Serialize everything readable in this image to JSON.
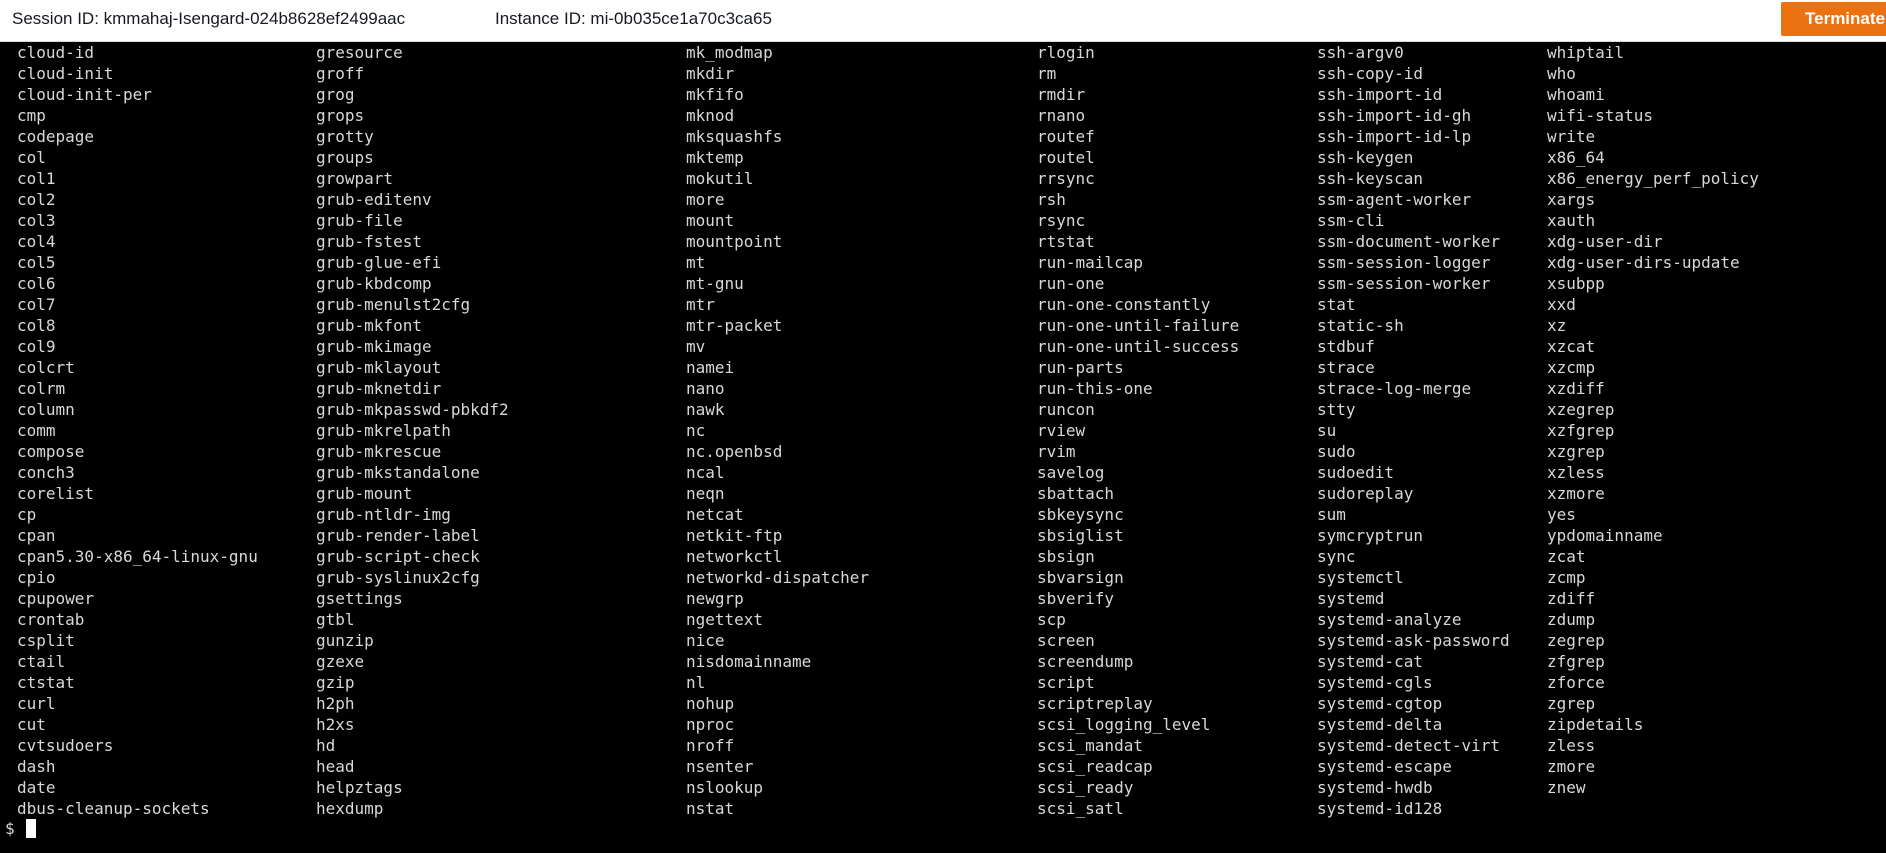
{
  "header": {
    "session_label": "Session ID: kmmahaj-Isengard-024b8628ef2499aac",
    "instance_label": "Instance ID: mi-0b035ce1a70c3ca65",
    "terminate_label": "Terminate"
  },
  "terminal": {
    "prompt": "$",
    "columns": [
      [
        "cloud-id",
        "cloud-init",
        "cloud-init-per",
        "cmp",
        "codepage",
        "col",
        "col1",
        "col2",
        "col3",
        "col4",
        "col5",
        "col6",
        "col7",
        "col8",
        "col9",
        "colcrt",
        "colrm",
        "column",
        "comm",
        "compose",
        "conch3",
        "corelist",
        "cp",
        "cpan",
        "cpan5.30-x86_64-linux-gnu",
        "cpio",
        "cpupower",
        "crontab",
        "csplit",
        "ctail",
        "ctstat",
        "curl",
        "cut",
        "cvtsudoers",
        "dash",
        "date",
        "dbus-cleanup-sockets"
      ],
      [
        "gresource",
        "groff",
        "grog",
        "grops",
        "grotty",
        "groups",
        "growpart",
        "grub-editenv",
        "grub-file",
        "grub-fstest",
        "grub-glue-efi",
        "grub-kbdcomp",
        "grub-menulst2cfg",
        "grub-mkfont",
        "grub-mkimage",
        "grub-mklayout",
        "grub-mknetdir",
        "grub-mkpasswd-pbkdf2",
        "grub-mkrelpath",
        "grub-mkrescue",
        "grub-mkstandalone",
        "grub-mount",
        "grub-ntldr-img",
        "grub-render-label",
        "grub-script-check",
        "grub-syslinux2cfg",
        "gsettings",
        "gtbl",
        "gunzip",
        "gzexe",
        "gzip",
        "h2ph",
        "h2xs",
        "hd",
        "head",
        "helpztags",
        "hexdump"
      ],
      [
        "mk_modmap",
        "mkdir",
        "mkfifo",
        "mknod",
        "mksquashfs",
        "mktemp",
        "mokutil",
        "more",
        "mount",
        "mountpoint",
        "mt",
        "mt-gnu",
        "mtr",
        "mtr-packet",
        "mv",
        "namei",
        "nano",
        "nawk",
        "nc",
        "nc.openbsd",
        "ncal",
        "neqn",
        "netcat",
        "netkit-ftp",
        "networkctl",
        "networkd-dispatcher",
        "newgrp",
        "ngettext",
        "nice",
        "nisdomainname",
        "nl",
        "nohup",
        "nproc",
        "nroff",
        "nsenter",
        "nslookup",
        "nstat"
      ],
      [
        "rlogin",
        "rm",
        "rmdir",
        "rnano",
        "routef",
        "routel",
        "rrsync",
        "rsh",
        "rsync",
        "rtstat",
        "run-mailcap",
        "run-one",
        "run-one-constantly",
        "run-one-until-failure",
        "run-one-until-success",
        "run-parts",
        "run-this-one",
        "runcon",
        "rview",
        "rvim",
        "savelog",
        "sbattach",
        "sbkeysync",
        "sbsiglist",
        "sbsign",
        "sbvarsign",
        "sbverify",
        "scp",
        "screen",
        "screendump",
        "script",
        "scriptreplay",
        "scsi_logging_level",
        "scsi_mandat",
        "scsi_readcap",
        "scsi_ready",
        "scsi_satl"
      ],
      [
        "ssh-argv0",
        "ssh-copy-id",
        "ssh-import-id",
        "ssh-import-id-gh",
        "ssh-import-id-lp",
        "ssh-keygen",
        "ssh-keyscan",
        "ssm-agent-worker",
        "ssm-cli",
        "ssm-document-worker",
        "ssm-session-logger",
        "ssm-session-worker",
        "stat",
        "static-sh",
        "stdbuf",
        "strace",
        "strace-log-merge",
        "stty",
        "su",
        "sudo",
        "sudoedit",
        "sudoreplay",
        "sum",
        "symcryptrun",
        "sync",
        "systemctl",
        "systemd",
        "systemd-analyze",
        "systemd-ask-password",
        "systemd-cat",
        "systemd-cgls",
        "systemd-cgtop",
        "systemd-delta",
        "systemd-detect-virt",
        "systemd-escape",
        "systemd-hwdb",
        "systemd-id128"
      ],
      [
        "whiptail",
        "who",
        "whoami",
        "wifi-status",
        "write",
        "x86_64",
        "x86_energy_perf_policy",
        "xargs",
        "xauth",
        "xdg-user-dir",
        "xdg-user-dirs-update",
        "xsubpp",
        "xxd",
        "xz",
        "xzcat",
        "xzcmp",
        "xzdiff",
        "xzegrep",
        "xzfgrep",
        "xzgrep",
        "xzless",
        "xzmore",
        "yes",
        "ypdomainname",
        "zcat",
        "zcmp",
        "zdiff",
        "zdump",
        "zegrep",
        "zfgrep",
        "zforce",
        "zgrep",
        "zipdetails",
        "zless",
        "zmore",
        "znew"
      ]
    ]
  },
  "colors": {
    "terminate_button": "#ec7211",
    "terminal_bg": "#000000",
    "terminal_fg": "#d8d8d8"
  }
}
